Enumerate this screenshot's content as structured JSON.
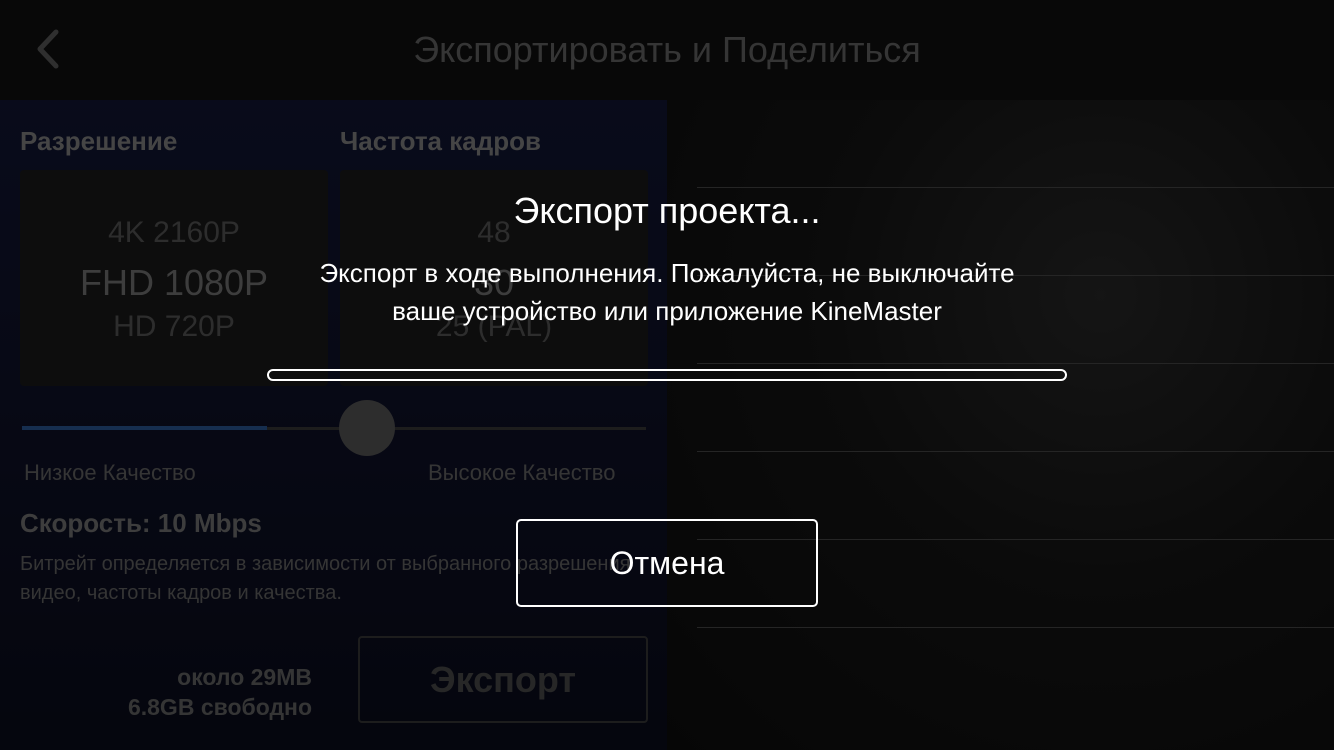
{
  "header": {
    "title": "Экспортировать и Поделиться",
    "back_icon": "chevron-left-icon"
  },
  "settings": {
    "resolution_label": "Разрешение",
    "framerate_label": "Частота кадров",
    "resolution_options": [
      "4K 2160P",
      "FHD 1080P",
      "HD 720P"
    ],
    "resolution_selected": "FHD 1080P",
    "framerate_options": [
      "48",
      "30",
      "25 (PAL)"
    ],
    "framerate_selected": "30",
    "quality_low_label": "Низкое Качество",
    "quality_high_label": "Высокое Качество",
    "speed_text": "Скорость: 10 Mbps",
    "bitrate_note": "Битрейт определяется в зависимости от выбранного разрешения видео, частоты кадров и качества.",
    "size_estimate": "около 29MB",
    "free_space": "6.8GB свободно",
    "export_button": "Экспорт"
  },
  "dialog": {
    "title": "Экспорт проекта...",
    "message_line1": "Экспорт в ходе выполнения. Пожалуйста, не выключайте",
    "message_line2": "ваше устройство или приложение KineMaster",
    "progress_percent": 0,
    "cancel_button": "Отмена"
  },
  "colors": {
    "accent": "#2d5d9f",
    "overlay_text": "#ffffff"
  }
}
